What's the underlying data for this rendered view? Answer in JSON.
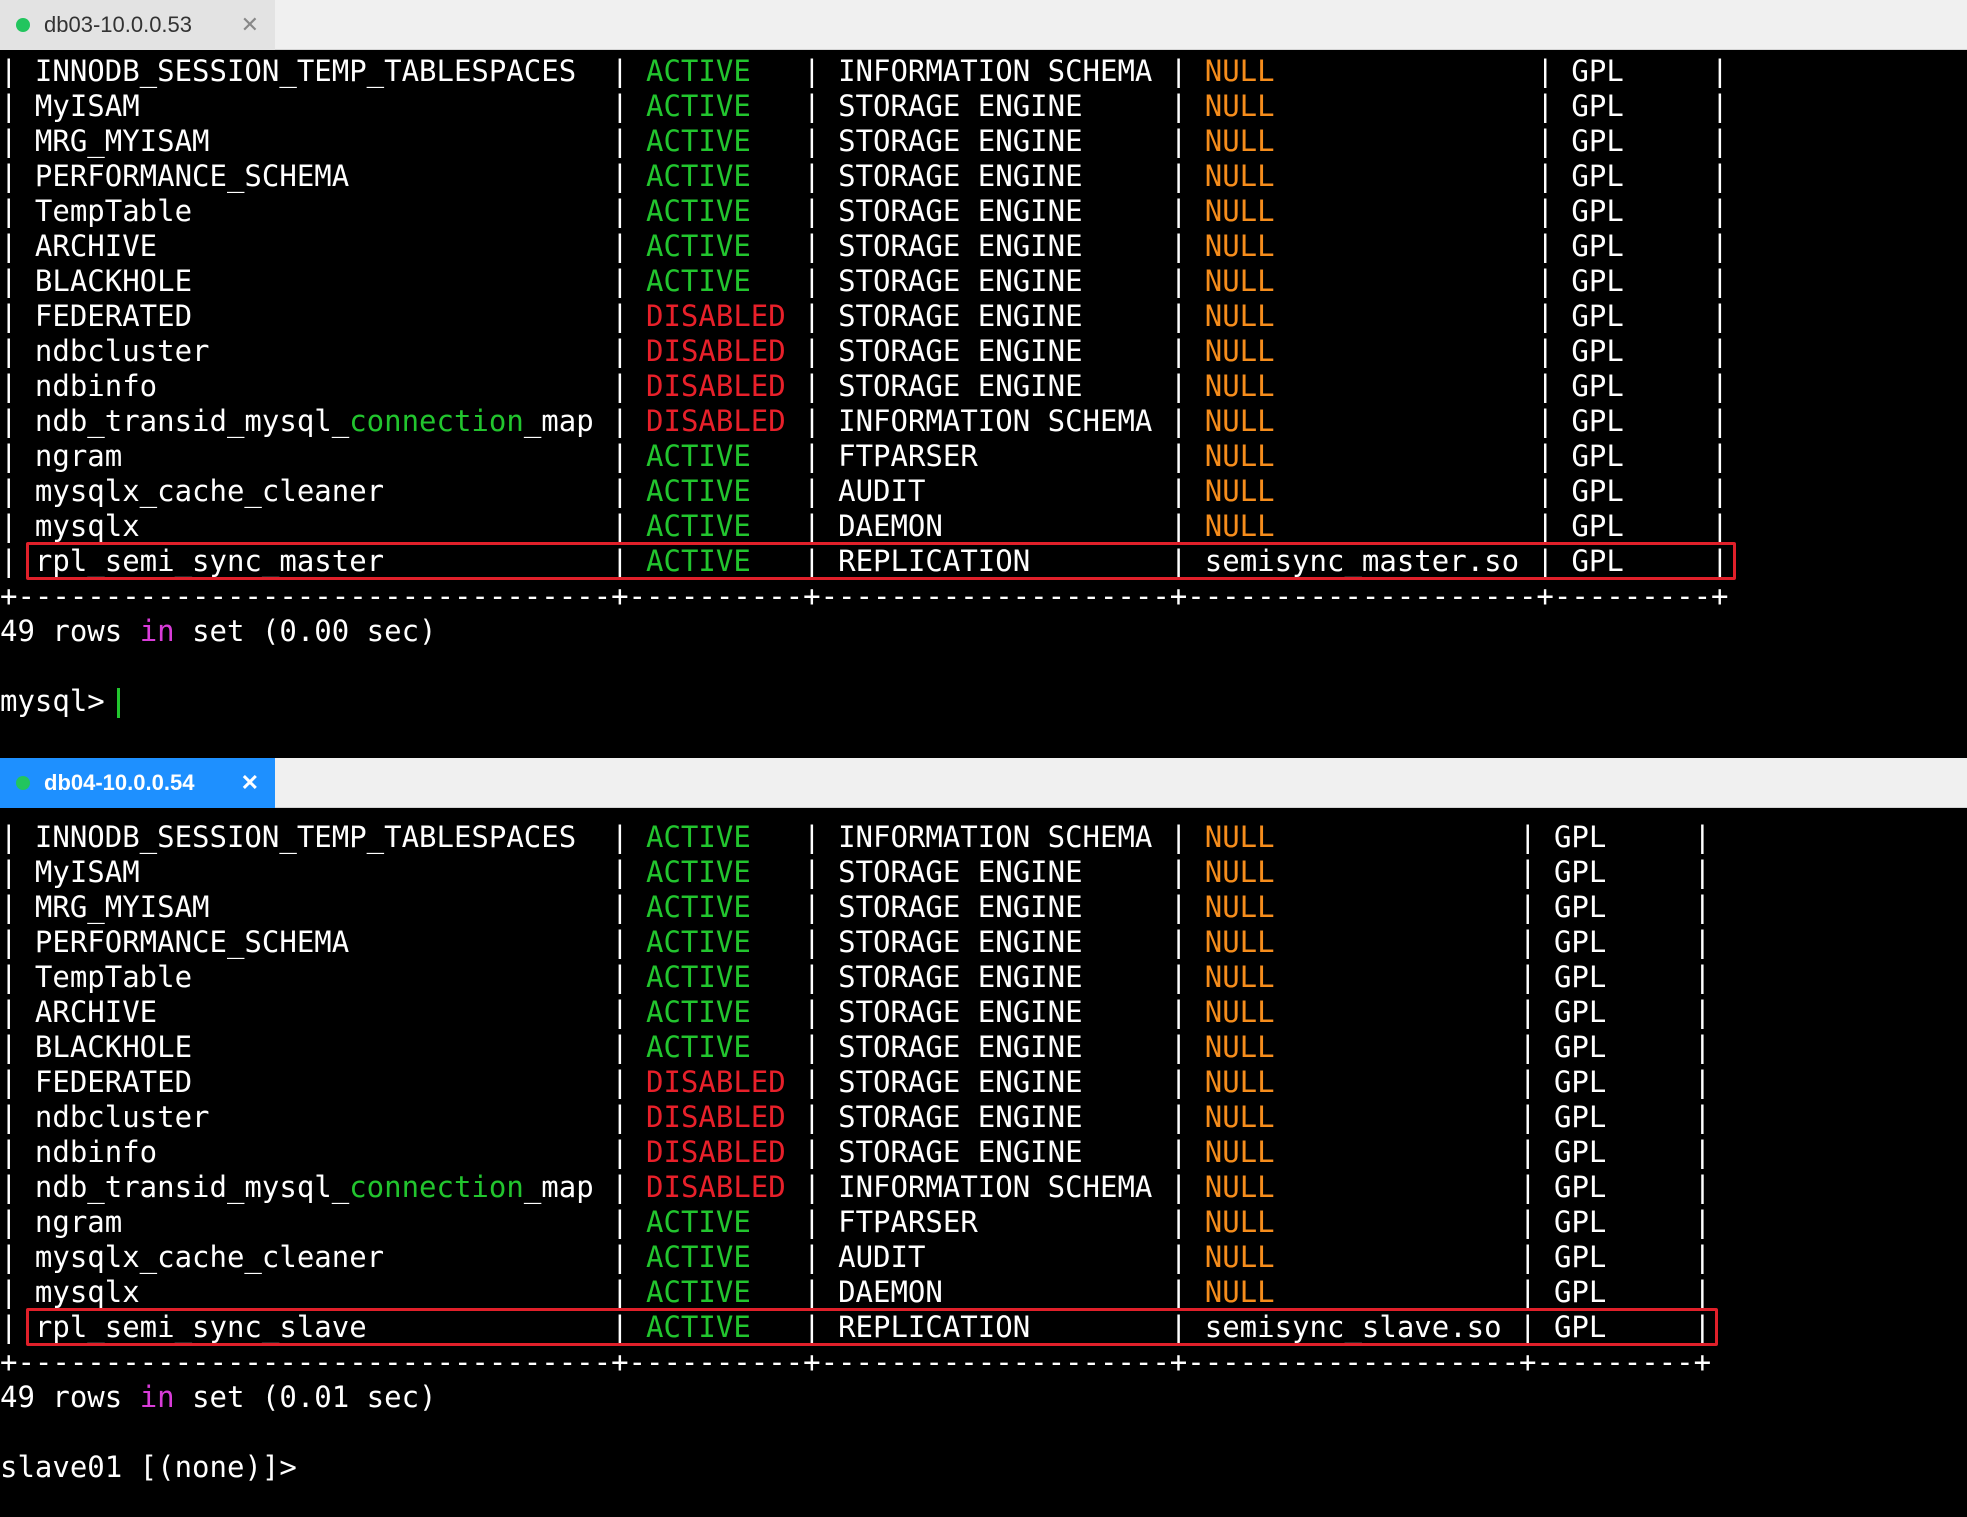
{
  "panes": [
    {
      "tab": {
        "title": "db03-10.0.0.53",
        "active": false
      },
      "columns": [
        "INNODB_SESSION_TEMP_TABLESPACES"
      ],
      "rows": [
        {
          "name": "INNODB_SESSION_TEMP_TABLESPACES",
          "status": "ACTIVE",
          "type": "INFORMATION SCHEMA",
          "library": "NULL",
          "license": "GPL"
        },
        {
          "name": "MyISAM",
          "status": "ACTIVE",
          "type": "STORAGE ENGINE",
          "library": "NULL",
          "license": "GPL"
        },
        {
          "name": "MRG_MYISAM",
          "status": "ACTIVE",
          "type": "STORAGE ENGINE",
          "library": "NULL",
          "license": "GPL"
        },
        {
          "name": "PERFORMANCE_SCHEMA",
          "status": "ACTIVE",
          "type": "STORAGE ENGINE",
          "library": "NULL",
          "license": "GPL"
        },
        {
          "name": "TempTable",
          "status": "ACTIVE",
          "type": "STORAGE ENGINE",
          "library": "NULL",
          "license": "GPL"
        },
        {
          "name": "ARCHIVE",
          "status": "ACTIVE",
          "type": "STORAGE ENGINE",
          "library": "NULL",
          "license": "GPL"
        },
        {
          "name": "BLACKHOLE",
          "status": "ACTIVE",
          "type": "STORAGE ENGINE",
          "library": "NULL",
          "license": "GPL"
        },
        {
          "name": "FEDERATED",
          "status": "DISABLED",
          "type": "STORAGE ENGINE",
          "library": "NULL",
          "license": "GPL"
        },
        {
          "name": "ndbcluster",
          "status": "DISABLED",
          "type": "STORAGE ENGINE",
          "library": "NULL",
          "license": "GPL"
        },
        {
          "name": "ndbinfo",
          "status": "DISABLED",
          "type": "STORAGE ENGINE",
          "library": "NULL",
          "license": "GPL"
        },
        {
          "name": "ndb_transid_mysql_connection_map",
          "status": "DISABLED",
          "type": "INFORMATION SCHEMA",
          "library": "NULL",
          "license": "GPL"
        },
        {
          "name": "ngram",
          "status": "ACTIVE",
          "type": "FTPARSER",
          "library": "NULL",
          "license": "GPL"
        },
        {
          "name": "mysqlx_cache_cleaner",
          "status": "ACTIVE",
          "type": "AUDIT",
          "library": "NULL",
          "license": "GPL"
        },
        {
          "name": "mysqlx",
          "status": "ACTIVE",
          "type": "DAEMON",
          "library": "NULL",
          "license": "GPL"
        },
        {
          "name": "rpl_semi_sync_master",
          "status": "ACTIVE",
          "type": "REPLICATION",
          "library": "semisync_master.so",
          "license": "GPL",
          "highlighted": true
        }
      ],
      "footer": {
        "count": "49",
        "rows_word": "rows",
        "in_word": "in",
        "set_text": "set (0.00 sec)"
      },
      "prompt": "mysql>"
    },
    {
      "tab": {
        "title": "db04-10.0.0.54",
        "active": true
      },
      "rows": [
        {
          "name": "INNODB_SESSION_TEMP_TABLESPACES",
          "status": "ACTIVE",
          "type": "INFORMATION SCHEMA",
          "library": "NULL",
          "license": "GPL"
        },
        {
          "name": "MyISAM",
          "status": "ACTIVE",
          "type": "STORAGE ENGINE",
          "library": "NULL",
          "license": "GPL"
        },
        {
          "name": "MRG_MYISAM",
          "status": "ACTIVE",
          "type": "STORAGE ENGINE",
          "library": "NULL",
          "license": "GPL"
        },
        {
          "name": "PERFORMANCE_SCHEMA",
          "status": "ACTIVE",
          "type": "STORAGE ENGINE",
          "library": "NULL",
          "license": "GPL"
        },
        {
          "name": "TempTable",
          "status": "ACTIVE",
          "type": "STORAGE ENGINE",
          "library": "NULL",
          "license": "GPL"
        },
        {
          "name": "ARCHIVE",
          "status": "ACTIVE",
          "type": "STORAGE ENGINE",
          "library": "NULL",
          "license": "GPL"
        },
        {
          "name": "BLACKHOLE",
          "status": "ACTIVE",
          "type": "STORAGE ENGINE",
          "library": "NULL",
          "license": "GPL"
        },
        {
          "name": "FEDERATED",
          "status": "DISABLED",
          "type": "STORAGE ENGINE",
          "library": "NULL",
          "license": "GPL"
        },
        {
          "name": "ndbcluster",
          "status": "DISABLED",
          "type": "STORAGE ENGINE",
          "library": "NULL",
          "license": "GPL"
        },
        {
          "name": "ndbinfo",
          "status": "DISABLED",
          "type": "STORAGE ENGINE",
          "library": "NULL",
          "license": "GPL"
        },
        {
          "name": "ndb_transid_mysql_connection_map",
          "status": "DISABLED",
          "type": "INFORMATION SCHEMA",
          "library": "NULL",
          "license": "GPL"
        },
        {
          "name": "ngram",
          "status": "ACTIVE",
          "type": "FTPARSER",
          "library": "NULL",
          "license": "GPL"
        },
        {
          "name": "mysqlx_cache_cleaner",
          "status": "ACTIVE",
          "type": "AUDIT",
          "library": "NULL",
          "license": "GPL"
        },
        {
          "name": "mysqlx",
          "status": "ACTIVE",
          "type": "DAEMON",
          "library": "NULL",
          "license": "GPL"
        },
        {
          "name": "rpl_semi_sync_slave",
          "status": "ACTIVE",
          "type": "REPLICATION",
          "library": "semisync_slave.so",
          "license": "GPL",
          "highlighted": true
        }
      ],
      "footer": {
        "count": "49",
        "rows_word": "rows",
        "in_word": "in",
        "set_text": "set (0.01 sec)"
      },
      "prompt": "slave01 [(none)]>"
    }
  ],
  "colors": {
    "active": "#22c52e",
    "disabled": "#e8202a",
    "null": "#f68d1c",
    "keyword": "#d83cd8",
    "highlight_box": "#e0202a",
    "tab_active": "#1e90ff"
  }
}
